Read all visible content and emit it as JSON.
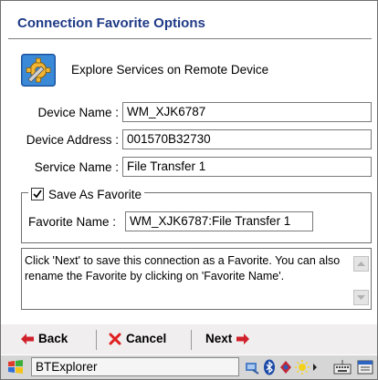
{
  "dialog": {
    "title": "Connection Favorite Options",
    "subtitle": "Explore Services on Remote Device",
    "icon": "gear-wrench-icon"
  },
  "fields": {
    "device_name_label": "Device Name :",
    "device_name_value": "WM_XJK6787",
    "device_address_label": "Device Address :",
    "device_address_value": "001570B32730",
    "service_name_label": "Service Name :",
    "service_name_value": "File Transfer 1"
  },
  "favorite": {
    "checkbox_label": "Save As Favorite",
    "checked": true,
    "name_label": "Favorite Name :",
    "name_value": "WM_XJK6787:File Transfer 1"
  },
  "help_text": "Click 'Next' to save this connection as a Favorite.  You can also rename the Favorite by clicking on 'Favorite Name'.",
  "commands": {
    "back": "Back",
    "cancel": "Cancel",
    "next": "Next"
  },
  "taskbar": {
    "app_name": "BTExplorer",
    "icons": [
      "start-icon",
      "connectivity-icon",
      "bluetooth-icon",
      "network-icon",
      "brightness-icon",
      "arrow-icon",
      "keyboard-icon",
      "menu-icon"
    ]
  },
  "colors": {
    "title": "#1f3a86",
    "arrow_red": "#d0202a",
    "cancel_x": "#e02020"
  }
}
